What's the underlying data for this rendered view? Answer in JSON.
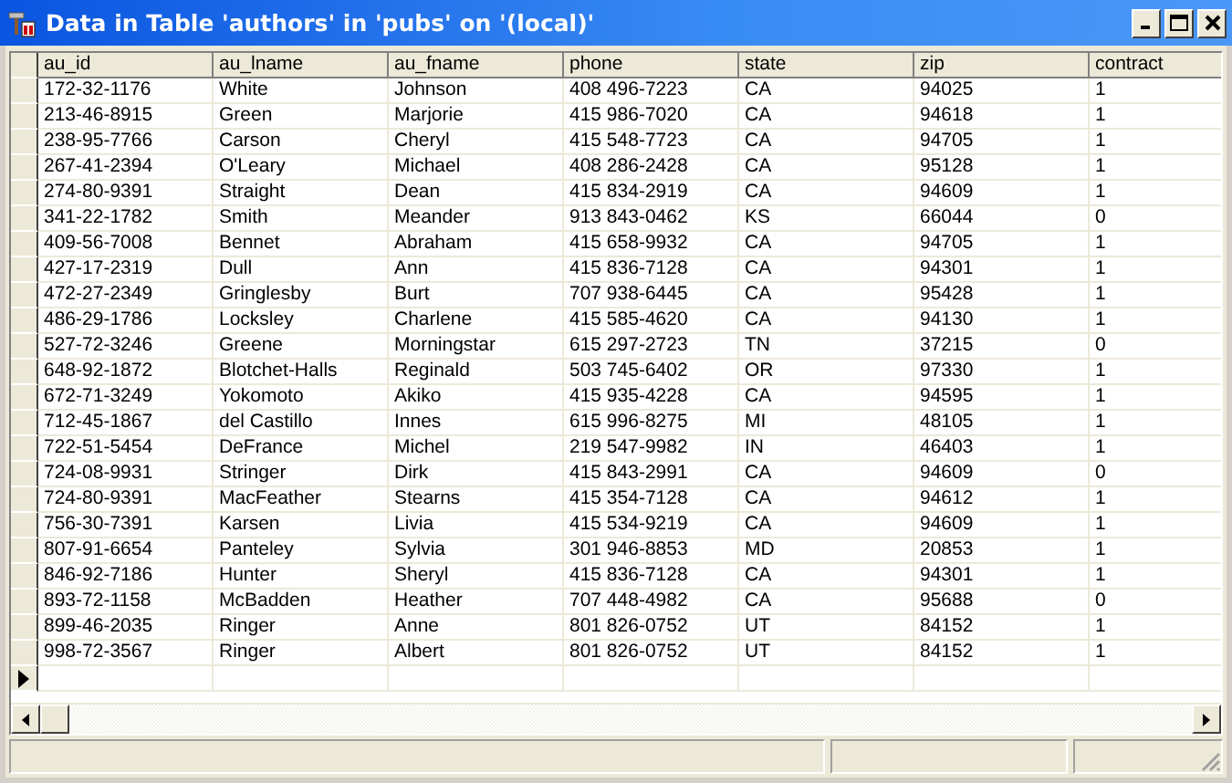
{
  "window": {
    "title": "Data in Table 'authors' in 'pubs' on '(local)'"
  },
  "table": {
    "columns": [
      "au_id",
      "au_lname",
      "au_fname",
      "phone",
      "state",
      "zip",
      "contract"
    ],
    "rows": [
      [
        "172-32-1176",
        "White",
        "Johnson",
        "408 496-7223",
        "CA",
        "94025",
        "1"
      ],
      [
        "213-46-8915",
        "Green",
        "Marjorie",
        "415 986-7020",
        "CA",
        "94618",
        "1"
      ],
      [
        "238-95-7766",
        "Carson",
        "Cheryl",
        "415 548-7723",
        "CA",
        "94705",
        "1"
      ],
      [
        "267-41-2394",
        "O'Leary",
        "Michael",
        "408 286-2428",
        "CA",
        "95128",
        "1"
      ],
      [
        "274-80-9391",
        "Straight",
        "Dean",
        "415 834-2919",
        "CA",
        "94609",
        "1"
      ],
      [
        "341-22-1782",
        "Smith",
        "Meander",
        "913 843-0462",
        "KS",
        "66044",
        "0"
      ],
      [
        "409-56-7008",
        "Bennet",
        "Abraham",
        "415 658-9932",
        "CA",
        "94705",
        "1"
      ],
      [
        "427-17-2319",
        "Dull",
        "Ann",
        "415 836-7128",
        "CA",
        "94301",
        "1"
      ],
      [
        "472-27-2349",
        "Gringlesby",
        "Burt",
        "707 938-6445",
        "CA",
        "95428",
        "1"
      ],
      [
        "486-29-1786",
        "Locksley",
        "Charlene",
        "415 585-4620",
        "CA",
        "94130",
        "1"
      ],
      [
        "527-72-3246",
        "Greene",
        "Morningstar",
        "615 297-2723",
        "TN",
        "37215",
        "0"
      ],
      [
        "648-92-1872",
        "Blotchet-Halls",
        "Reginald",
        "503 745-6402",
        "OR",
        "97330",
        "1"
      ],
      [
        "672-71-3249",
        "Yokomoto",
        "Akiko",
        "415 935-4228",
        "CA",
        "94595",
        "1"
      ],
      [
        "712-45-1867",
        "del Castillo",
        "Innes",
        "615 996-8275",
        "MI",
        "48105",
        "1"
      ],
      [
        "722-51-5454",
        "DeFrance",
        "Michel",
        "219 547-9982",
        "IN",
        "46403",
        "1"
      ],
      [
        "724-08-9931",
        "Stringer",
        "Dirk",
        "415 843-2991",
        "CA",
        "94609",
        "0"
      ],
      [
        "724-80-9391",
        "MacFeather",
        "Stearns",
        "415 354-7128",
        "CA",
        "94612",
        "1"
      ],
      [
        "756-30-7391",
        "Karsen",
        "Livia",
        "415 534-9219",
        "CA",
        "94609",
        "1"
      ],
      [
        "807-91-6654",
        "Panteley",
        "Sylvia",
        "301 946-8853",
        "MD",
        "20853",
        "1"
      ],
      [
        "846-92-7186",
        "Hunter",
        "Sheryl",
        "415 836-7128",
        "CA",
        "94301",
        "1"
      ],
      [
        "893-72-1158",
        "McBadden",
        "Heather",
        "707 448-4982",
        "CA",
        "95688",
        "0"
      ],
      [
        "899-46-2035",
        "Ringer",
        "Anne",
        "801 826-0752",
        "UT",
        "84152",
        "1"
      ],
      [
        "998-72-3567",
        "Ringer",
        "Albert",
        "801 826-0752",
        "UT",
        "84152",
        "1"
      ]
    ]
  }
}
